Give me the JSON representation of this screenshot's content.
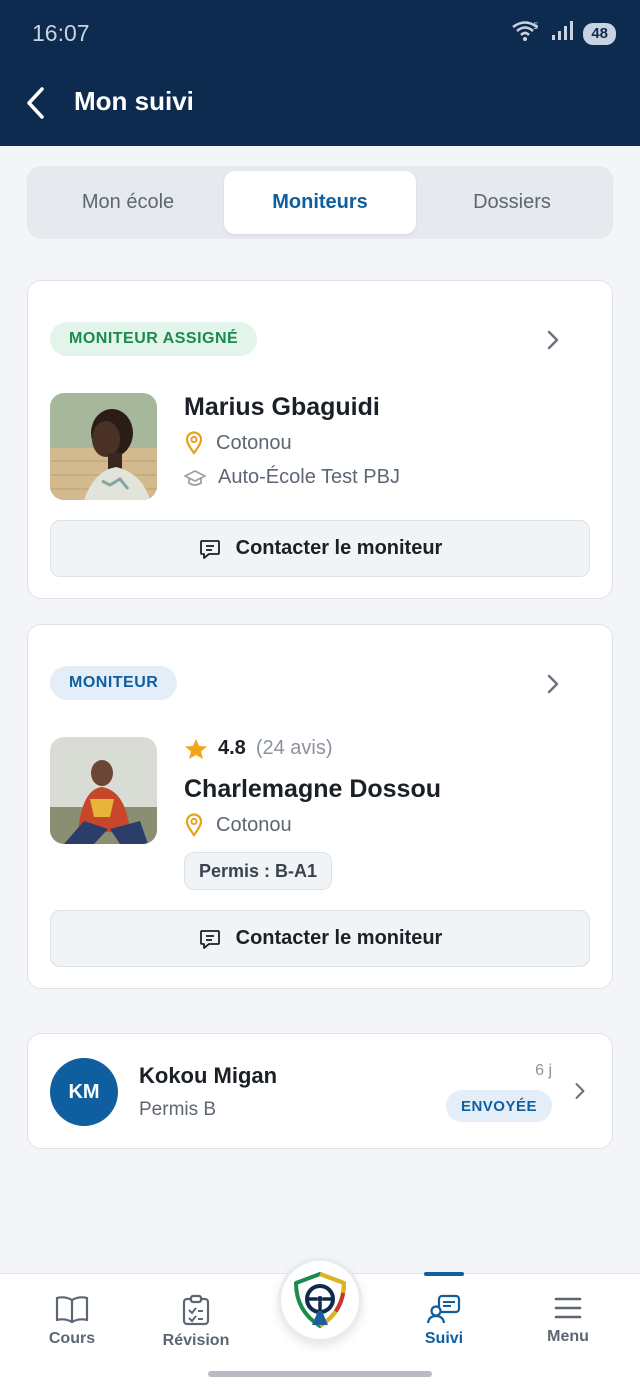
{
  "status_bar": {
    "time": "16:07",
    "wifi_badge": "5",
    "battery": "48"
  },
  "header": {
    "title": "Mon suivi"
  },
  "tabs": [
    {
      "label": "Mon école",
      "active": false
    },
    {
      "label": "Moniteurs",
      "active": true
    },
    {
      "label": "Dossiers",
      "active": false
    }
  ],
  "assigned_instructor": {
    "badge": "MONITEUR ASSIGNÉ",
    "name": "Marius Gbaguidi",
    "city": "Cotonou",
    "school": "Auto-École Test PBJ",
    "contact_label": "Contacter le moniteur"
  },
  "instructor": {
    "badge": "MONITEUR",
    "rating": "4.8",
    "reviews": "(24 avis)",
    "name": "Charlemagne Dossou",
    "city": "Cotonou",
    "permis": "Permis : B-A1",
    "contact_label": "Contacter le moniteur"
  },
  "student": {
    "initials": "KM",
    "name": "Kokou Migan",
    "permis": "Permis B",
    "time_ago": "6 j",
    "status": "ENVOYÉE"
  },
  "bottom_nav": [
    {
      "label": "Cours",
      "icon": "book-icon"
    },
    {
      "label": "Révision",
      "icon": "clipboard-check-icon"
    },
    {
      "label": "Suivi",
      "icon": "tracking-icon",
      "active": true
    },
    {
      "label": "Menu",
      "icon": "menu-icon"
    }
  ],
  "colors": {
    "header": "#0d2b4e",
    "accent": "#0f5fa0",
    "assigned_badge": "#1a8a4f",
    "pin": "#e8a11a",
    "star": "#f2a516"
  }
}
